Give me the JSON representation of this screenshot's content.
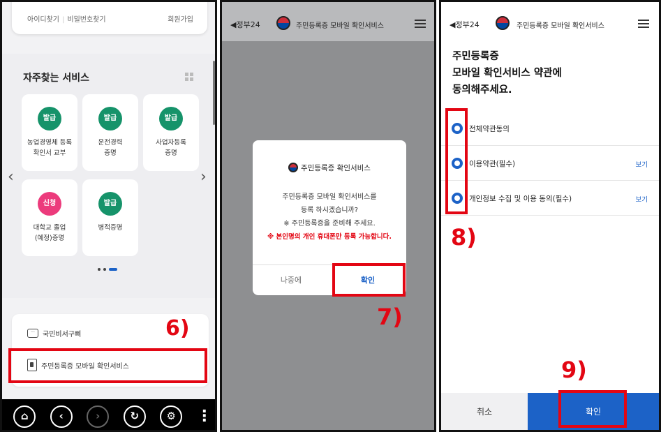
{
  "panel1": {
    "login": {
      "find_id": "아이디찾기",
      "find_pw": "비밀번호찾기",
      "signup": "회원가입"
    },
    "fav_title": "자주찾는 서비스",
    "tiles": [
      {
        "badge": "발급",
        "label": "농업경영체 등록\n확인서 교부"
      },
      {
        "badge": "발급",
        "label": "운전경력\n증명"
      },
      {
        "badge": "발급",
        "label": "사업자등록\n증명"
      },
      {
        "badge": "신청",
        "label": "대학교 졸업\n(예정)증명"
      },
      {
        "badge": "발급",
        "label": "병적증명"
      }
    ],
    "menu": {
      "chatbot": "국민비서구삐",
      "mobile_id": "주민등록증 모바일 확인서비스"
    },
    "step": "6)"
  },
  "panel2": {
    "header": {
      "back": "◀정부24",
      "title": "주민등록증 모바일 확인서비스"
    },
    "modal": {
      "title": "주민등록증 확인서비스",
      "line1": "주민등록증 모바일 확인서비스를",
      "line2": "등록 하시겠습니까?",
      "line3": "※ 주민등록증을 준비해 주세요.",
      "warning": "※ 본인명의 개인 휴대폰만 등록 가능합니다.",
      "later": "나중에",
      "ok": "확인"
    },
    "step": "7)"
  },
  "panel3": {
    "header": {
      "back": "◀정부24",
      "title": "주민등록증 모바일 확인서비스"
    },
    "title_line1": "주민등록증",
    "title_line2": "모바일 확인서비스 약관에",
    "title_line3": "동의해주세요.",
    "checks": [
      {
        "label": "전체약관동의",
        "view": ""
      },
      {
        "label": "이용약관(필수)",
        "view": "보기"
      },
      {
        "label": "개인정보 수집 및 이용 동의(필수)",
        "view": "보기"
      }
    ],
    "cancel": "취소",
    "ok": "확인",
    "step_checks": "8)",
    "step_ok": "9)"
  }
}
